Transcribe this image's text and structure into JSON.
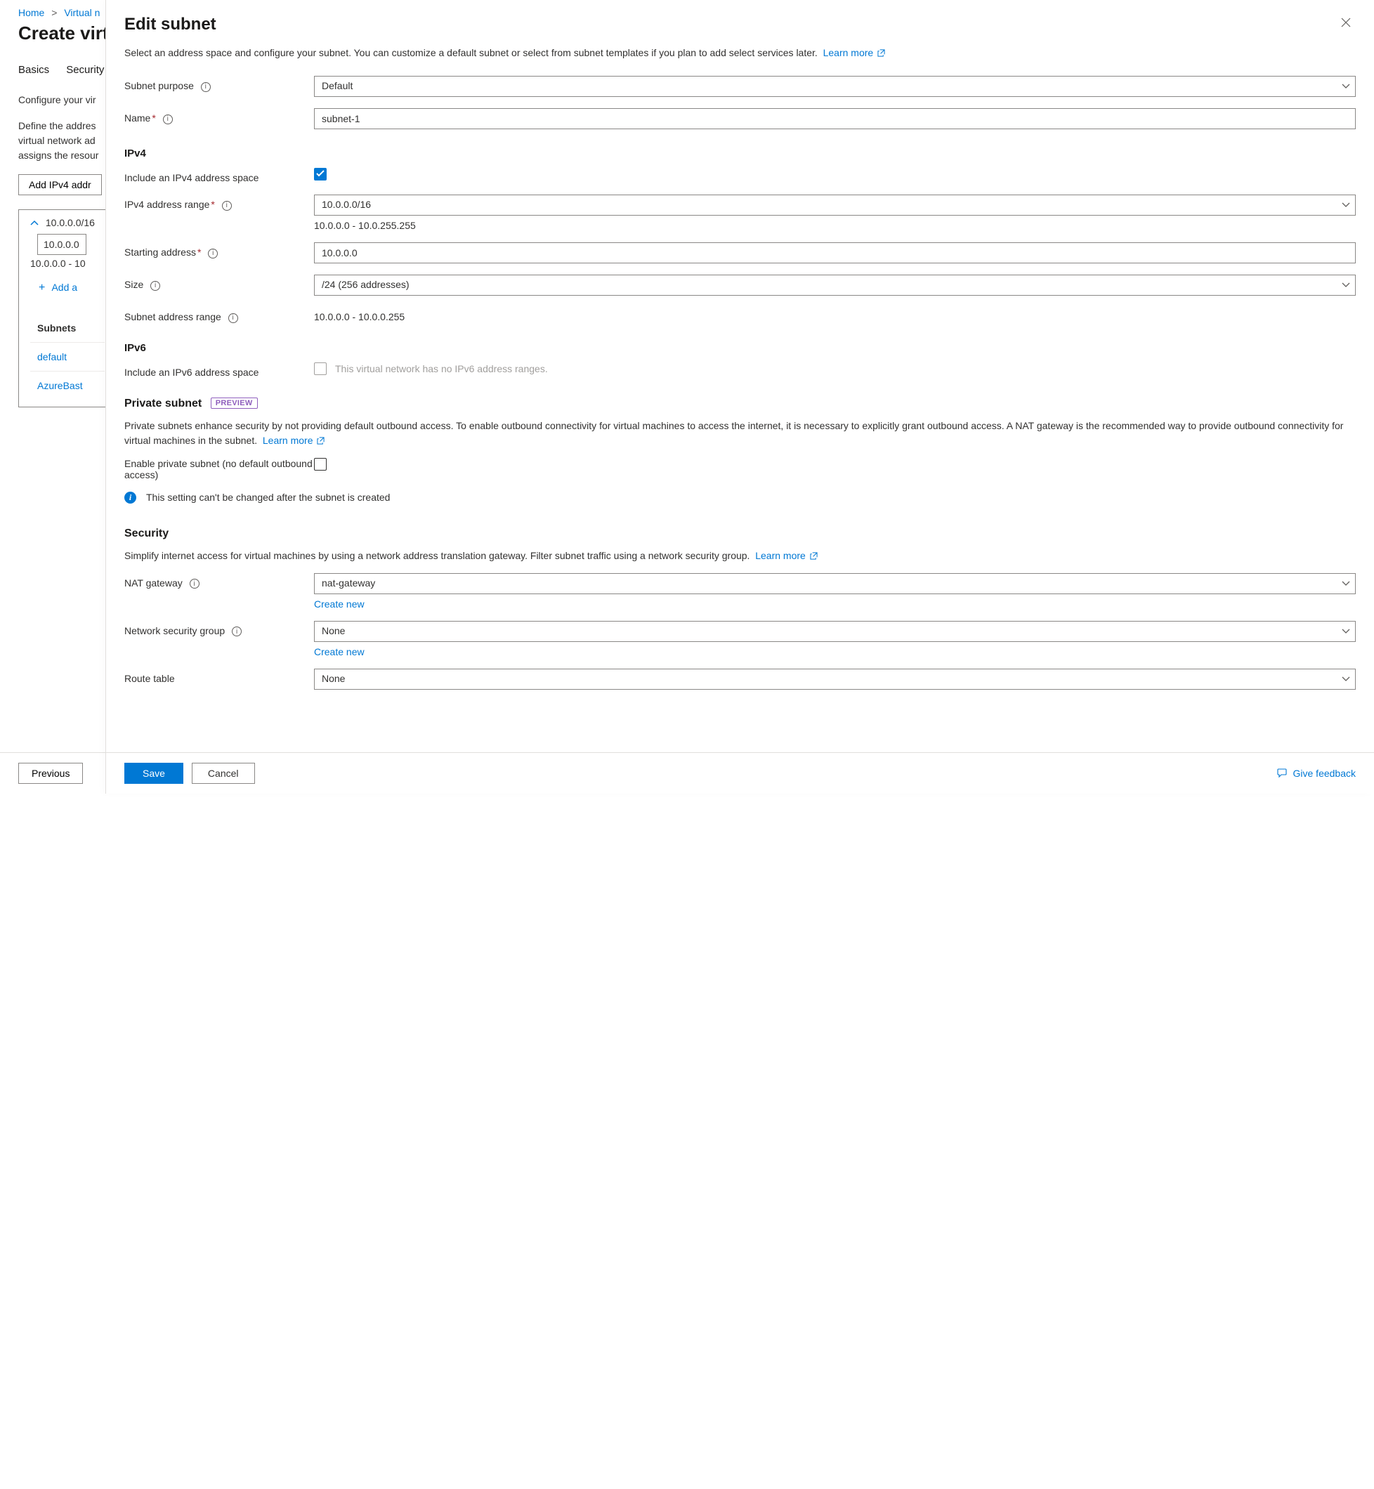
{
  "bg": {
    "breadcrumb": {
      "home": "Home",
      "vnet": "Virtual n"
    },
    "title": "Create virt",
    "tabs": {
      "basics": "Basics",
      "security": "Security"
    },
    "conf": "Configure your vir",
    "def1": "Define the addres",
    "def2": "virtual network ad",
    "def3": "assigns the resour",
    "add_space": "Add IPv4 addr",
    "cidr": "10.0.0.0/16",
    "addr": "10.0.0.0",
    "range": "10.0.0.0 - 10",
    "add_a": "Add a",
    "subnets": "Subnets",
    "sub1": "default",
    "sub2": "AzureBast",
    "previous": "Previous"
  },
  "panel": {
    "title": "Edit subnet",
    "intro": "Select an address space and configure your subnet. You can customize a default subnet or select from subnet templates if you plan to add select services later.",
    "learn_more": "Learn more",
    "fields": {
      "purpose": {
        "label": "Subnet purpose",
        "value": "Default"
      },
      "name": {
        "label": "Name",
        "value": "subnet-1"
      },
      "ipv4_head": "IPv4",
      "include_v4": {
        "label": "Include an IPv4 address space",
        "checked": true
      },
      "v4range": {
        "label": "IPv4 address range",
        "value": "10.0.0.0/16",
        "helper": "10.0.0.0 - 10.0.255.255"
      },
      "start": {
        "label": "Starting address",
        "value": "10.0.0.0"
      },
      "size": {
        "label": "Size",
        "value": "/24 (256 addresses)"
      },
      "subnet_range": {
        "label": "Subnet address range",
        "value": "10.0.0.0 - 10.0.0.255"
      },
      "ipv6_head": "IPv6",
      "include_v6": {
        "label": "Include an IPv6 address space",
        "hint": "This virtual network has no IPv6 address ranges."
      },
      "private_head": "Private subnet",
      "preview": "PREVIEW",
      "private_desc": "Private subnets enhance security by not providing default outbound access. To enable outbound connectivity for virtual machines to access the internet, it is necessary to explicitly grant outbound access. A NAT gateway is the recommended way to provide outbound connectivity for virtual machines in the subnet.",
      "enable_private": {
        "label": "Enable private subnet (no default outbound access)"
      },
      "info_callout": "This setting can't be changed after the subnet is created",
      "security_head": "Security",
      "security_desc": "Simplify internet access for virtual machines by using a network address translation gateway. Filter subnet traffic using a network security group.",
      "nat": {
        "label": "NAT gateway",
        "value": "nat-gateway",
        "create": "Create new"
      },
      "nsg": {
        "label": "Network security group",
        "value": "None",
        "create": "Create new"
      },
      "route": {
        "label": "Route table",
        "value": "None"
      }
    },
    "footer": {
      "save": "Save",
      "cancel": "Cancel",
      "feedback": "Give feedback"
    }
  }
}
